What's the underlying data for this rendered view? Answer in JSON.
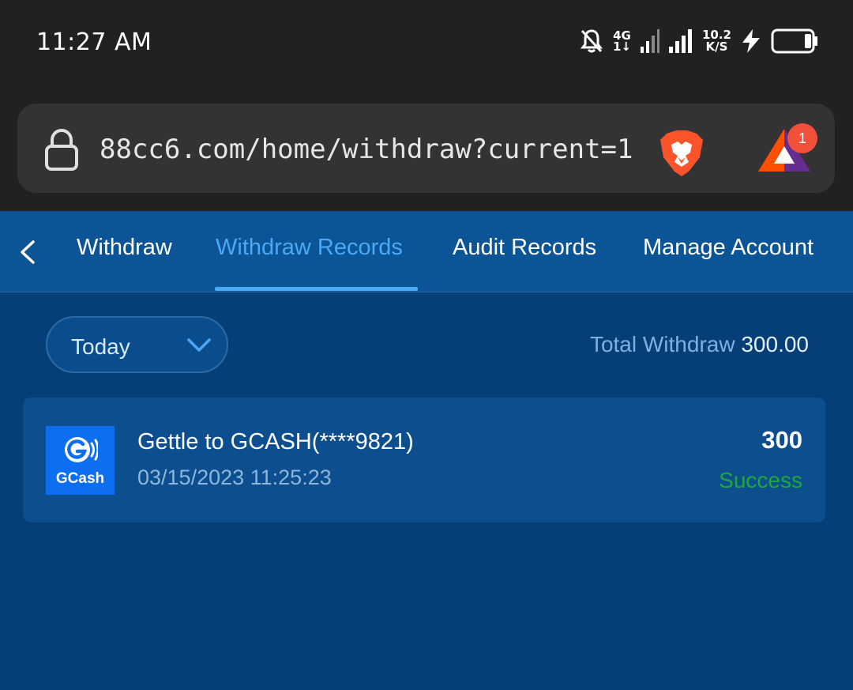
{
  "status_bar": {
    "time": "11:27 AM",
    "network_type": "4G",
    "network_sub": "1↓",
    "speed_value": "10.2",
    "speed_unit": "K/S"
  },
  "browser": {
    "url": "88cc6.com/home/withdraw?current=1",
    "notification_count": "1",
    "icons": [
      "lock-icon",
      "brave-lion-icon",
      "bat-rewards-icon"
    ]
  },
  "tabs": {
    "items": [
      {
        "label": "Withdraw",
        "active": false
      },
      {
        "label": "Withdraw Records",
        "active": true
      },
      {
        "label": "Audit Records",
        "active": false
      },
      {
        "label": "Manage Account",
        "active": false
      }
    ]
  },
  "filter": {
    "selected": "Today",
    "total_label": "Total Withdraw",
    "total_value": "300.00"
  },
  "records": [
    {
      "provider": "GCash",
      "title": "Gettle to GCASH(****9821)",
      "datetime": "03/15/2023 11:25:23",
      "amount": "300",
      "status": "Success"
    }
  ],
  "colors": {
    "page_bg": "#063f78",
    "tab_bar_bg": "#0b5495",
    "accent": "#4aa9f5",
    "success": "#1ea73a",
    "gcash_blue": "#0c6ff0"
  }
}
